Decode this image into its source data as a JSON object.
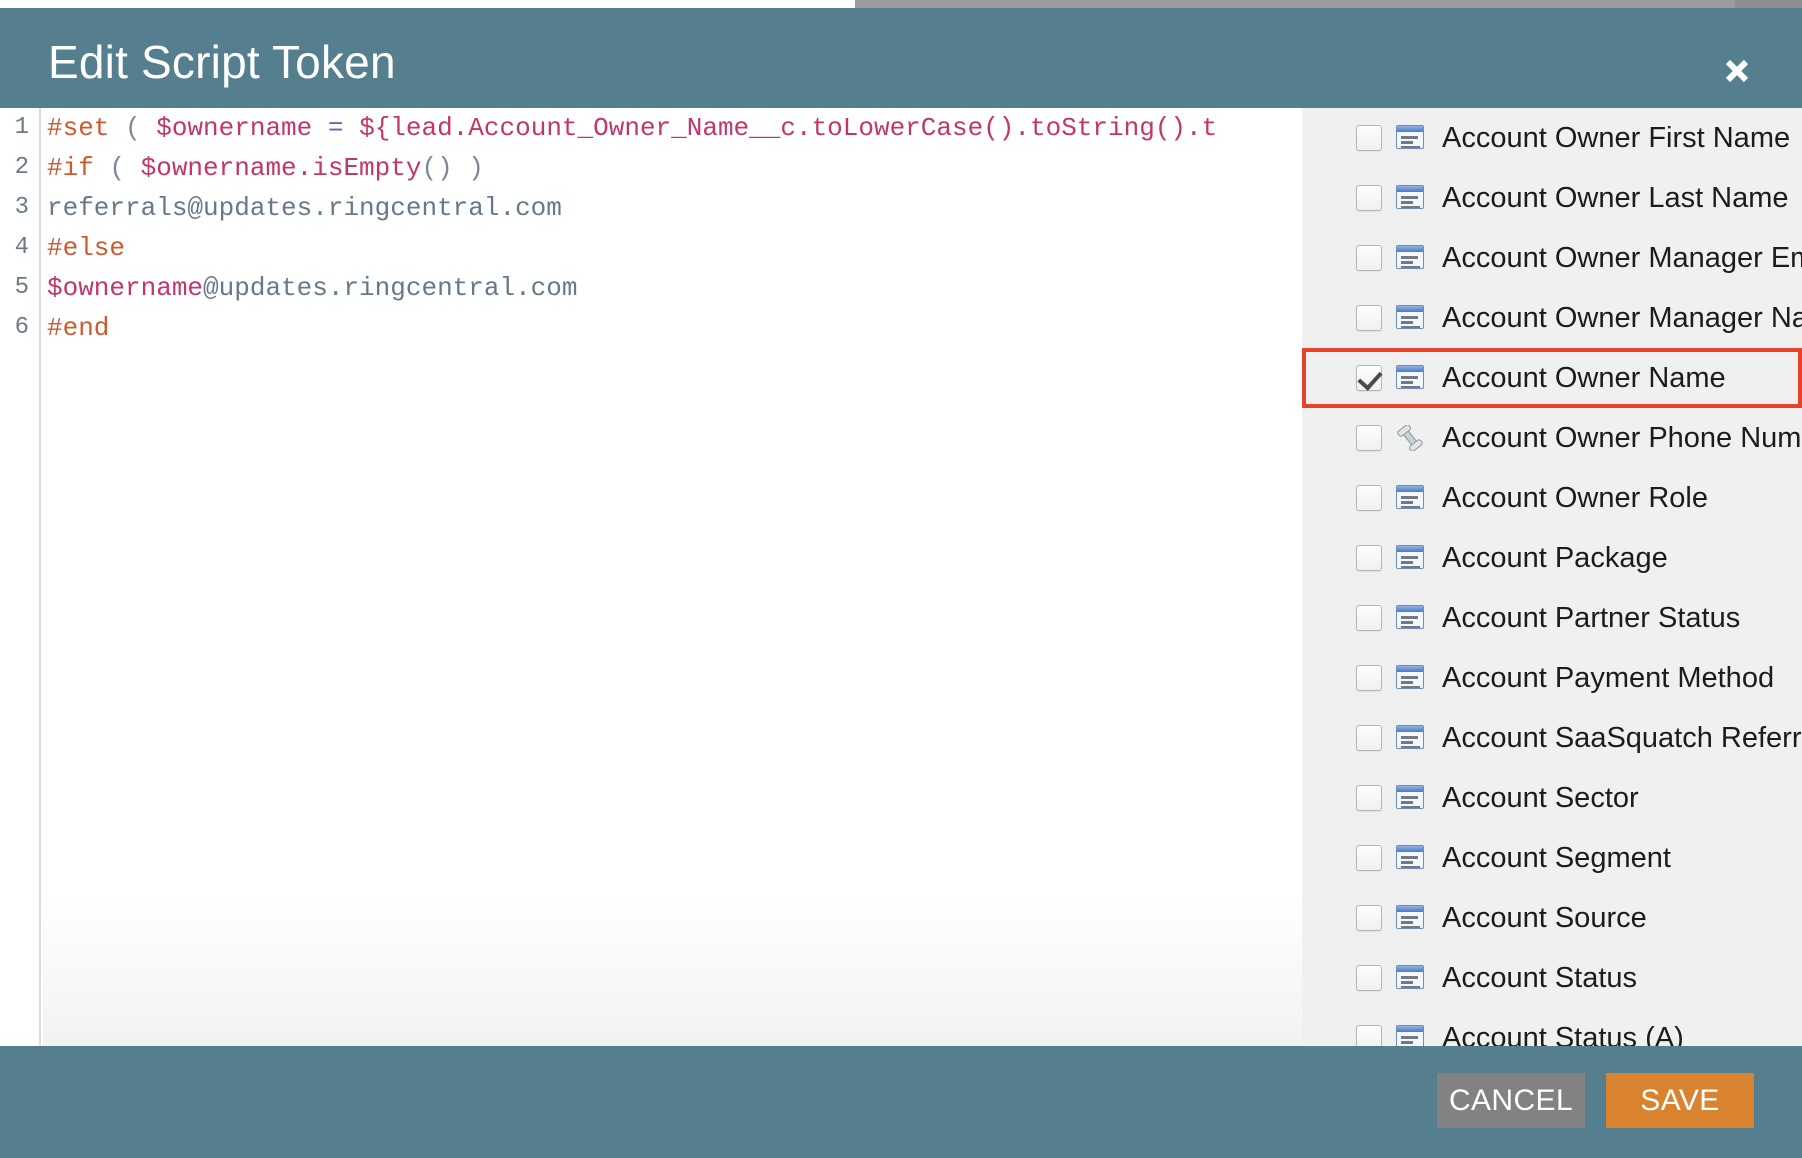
{
  "modal": {
    "title": "Edit Script Token",
    "close_icon": "close-icon",
    "accent_header_color": "#557e8e",
    "panel_bg_color": "#eff0ef",
    "highlight_color": "#e8432a"
  },
  "editor": {
    "line_numbers": [
      "1",
      "2",
      "3",
      "4",
      "5",
      "6"
    ],
    "lines": [
      {
        "number": "1",
        "text": "#set ( $ownername = ${lead.Account_Owner_Name__c.toLowerCase().toString().t",
        "tokens": [
          {
            "t": "#set",
            "c": "dir"
          },
          {
            "t": " ( ",
            "c": "punct"
          },
          {
            "t": "$ownername",
            "c": "var"
          },
          {
            "t": " ",
            "c": "plain"
          },
          {
            "t": "=",
            "c": "op"
          },
          {
            "t": " ",
            "c": "plain"
          },
          {
            "t": "${lead.Account_Owner_Name__c.toLowerCase().toString().t",
            "c": "ref"
          }
        ]
      },
      {
        "number": "2",
        "text": "#if ( $ownername.isEmpty() )",
        "tokens": [
          {
            "t": "#if",
            "c": "dir"
          },
          {
            "t": " ( ",
            "c": "punct"
          },
          {
            "t": "$ownername.isEmpty",
            "c": "var"
          },
          {
            "t": "() )",
            "c": "punct"
          }
        ]
      },
      {
        "number": "3",
        "text": "referrals@updates.ringcentral.com",
        "tokens": [
          {
            "t": "referrals@updates.ringcentral.com",
            "c": "plain"
          }
        ]
      },
      {
        "number": "4",
        "text": "#else",
        "tokens": [
          {
            "t": "#else",
            "c": "dir"
          }
        ]
      },
      {
        "number": "5",
        "text": "$ownername@updates.ringcentral.com",
        "tokens": [
          {
            "t": "$ownername",
            "c": "var"
          },
          {
            "t": "@updates.ringcentral.com",
            "c": "plain"
          }
        ]
      },
      {
        "number": "6",
        "text": "#end",
        "tokens": [
          {
            "t": "#end",
            "c": "dir"
          }
        ]
      }
    ]
  },
  "field_picker": {
    "fields": [
      {
        "label": "Account Owner First Name",
        "icon": "text-field-icon",
        "checked": false,
        "highlighted": false
      },
      {
        "label": "Account Owner Last Name",
        "icon": "text-field-icon",
        "checked": false,
        "highlighted": false
      },
      {
        "label": "Account Owner Manager Email",
        "icon": "text-field-icon",
        "checked": false,
        "highlighted": false
      },
      {
        "label": "Account Owner Manager Name",
        "icon": "text-field-icon",
        "checked": false,
        "highlighted": false
      },
      {
        "label": "Account Owner Name",
        "icon": "text-field-icon",
        "checked": true,
        "highlighted": true
      },
      {
        "label": "Account Owner Phone Number",
        "icon": "phone-icon",
        "checked": false,
        "highlighted": false
      },
      {
        "label": "Account Owner Role",
        "icon": "text-field-icon",
        "checked": false,
        "highlighted": false
      },
      {
        "label": "Account Package",
        "icon": "text-field-icon",
        "checked": false,
        "highlighted": false
      },
      {
        "label": "Account Partner Status",
        "icon": "text-field-icon",
        "checked": false,
        "highlighted": false
      },
      {
        "label": "Account Payment Method",
        "icon": "text-field-icon",
        "checked": false,
        "highlighted": false
      },
      {
        "label": "Account SaaSquatch Referral Enabled",
        "icon": "text-field-icon",
        "checked": false,
        "highlighted": false
      },
      {
        "label": "Account Sector",
        "icon": "text-field-icon",
        "checked": false,
        "highlighted": false
      },
      {
        "label": "Account Segment",
        "icon": "text-field-icon",
        "checked": false,
        "highlighted": false
      },
      {
        "label": "Account Source",
        "icon": "text-field-icon",
        "checked": false,
        "highlighted": false
      },
      {
        "label": "Account Status",
        "icon": "text-field-icon",
        "checked": false,
        "highlighted": false
      },
      {
        "label": "Account Status (A)",
        "icon": "text-field-icon",
        "checked": false,
        "highlighted": false
      }
    ]
  },
  "footer": {
    "cancel_label": "CANCEL",
    "save_label": "SAVE"
  }
}
